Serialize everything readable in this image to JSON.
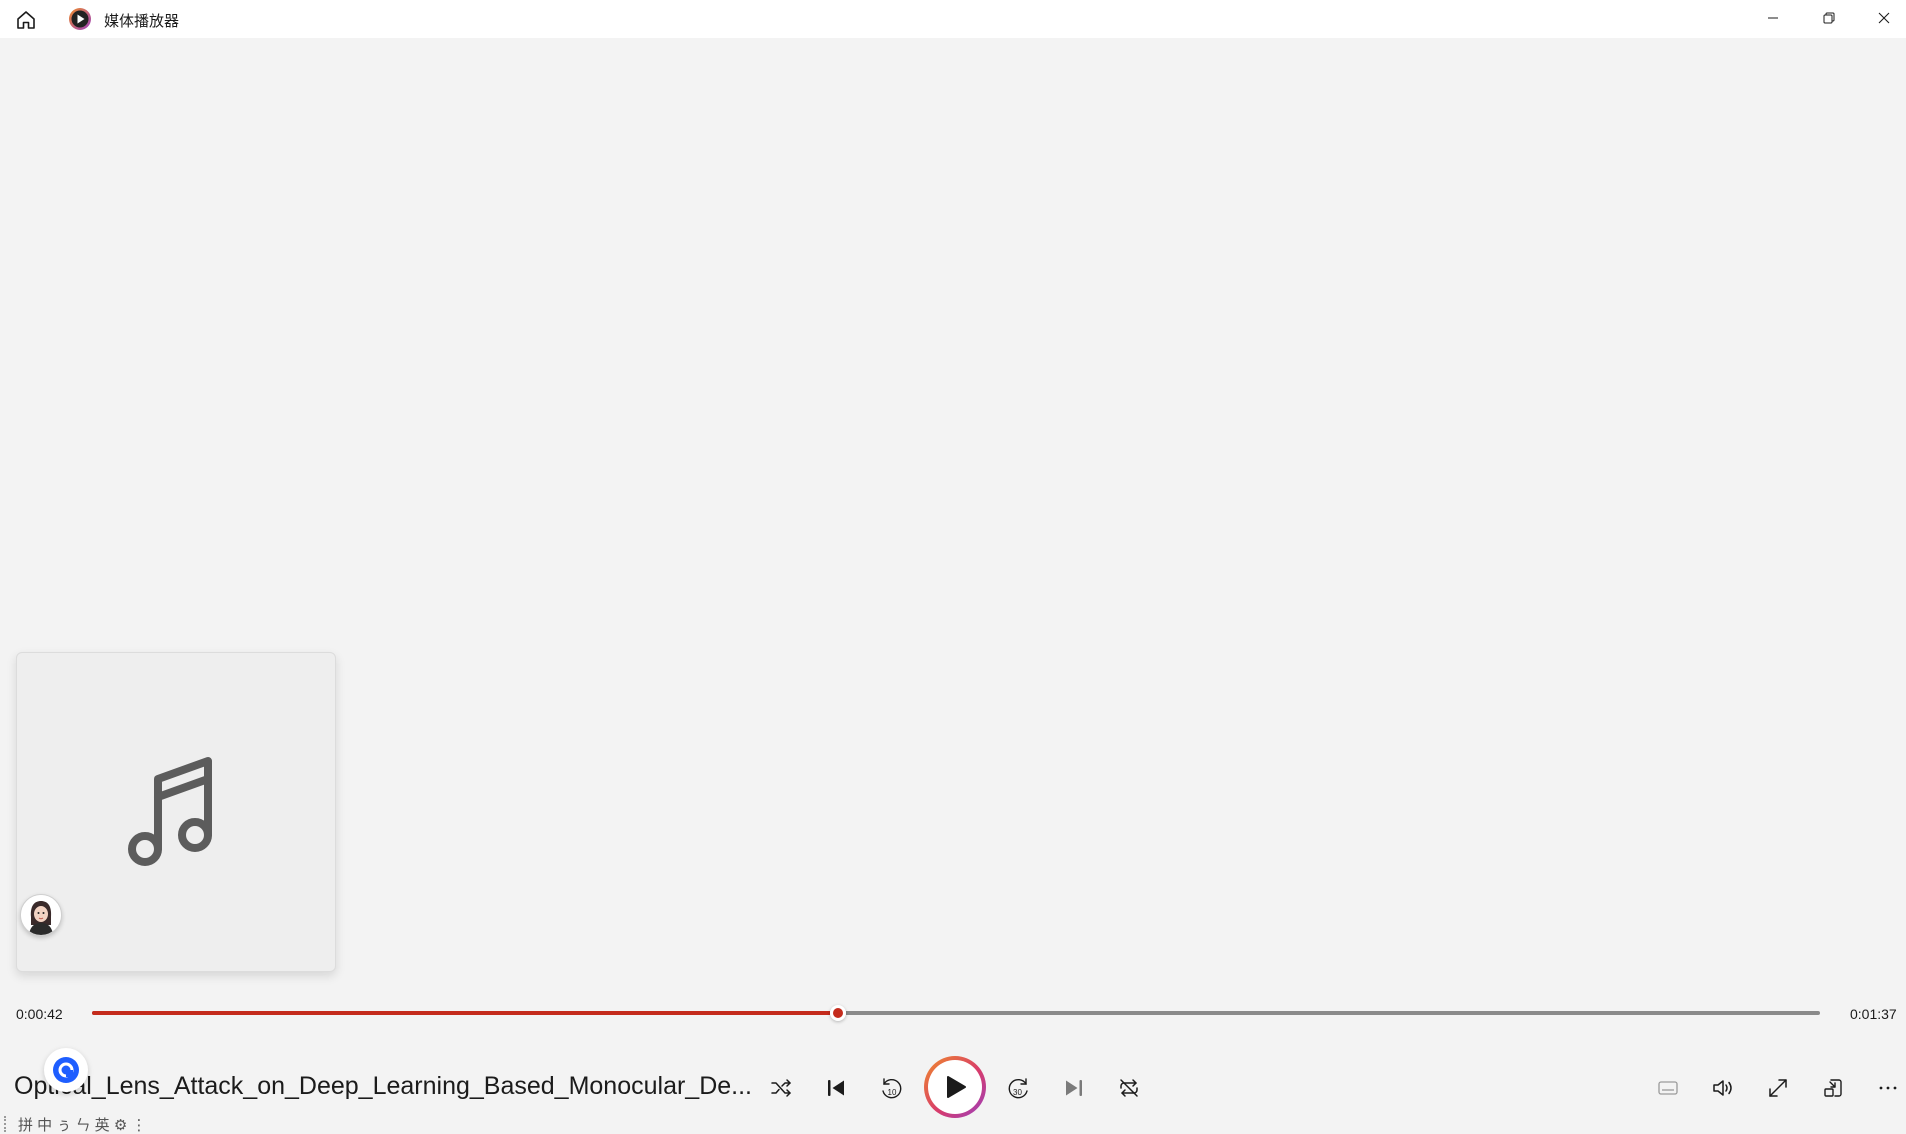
{
  "window": {
    "app_title": "媒体播放器",
    "controls": [
      "minimize",
      "restore",
      "close"
    ]
  },
  "icons": {
    "home": "home-icon",
    "app_logo": "media-player-logo-icon",
    "album_placeholder": "music-note-icon"
  },
  "playback": {
    "current_time": "0:00:42",
    "total_time": "0:01:37",
    "progress_fraction": 0.432,
    "is_playing": false
  },
  "now_playing": {
    "title": "Optical_Lens_Attack_on_Deep_Learning_Based_Monocular_De..."
  },
  "ime_toolbar": {
    "text": "拼 中 ぅ ㄣ 英 ⚙ ⋮"
  },
  "colors": {
    "accent": "#c42b1c",
    "background": "#f3f3f3",
    "play_gradient": [
      "#f08c2a",
      "#d83c6a",
      "#9a3fbf"
    ]
  }
}
